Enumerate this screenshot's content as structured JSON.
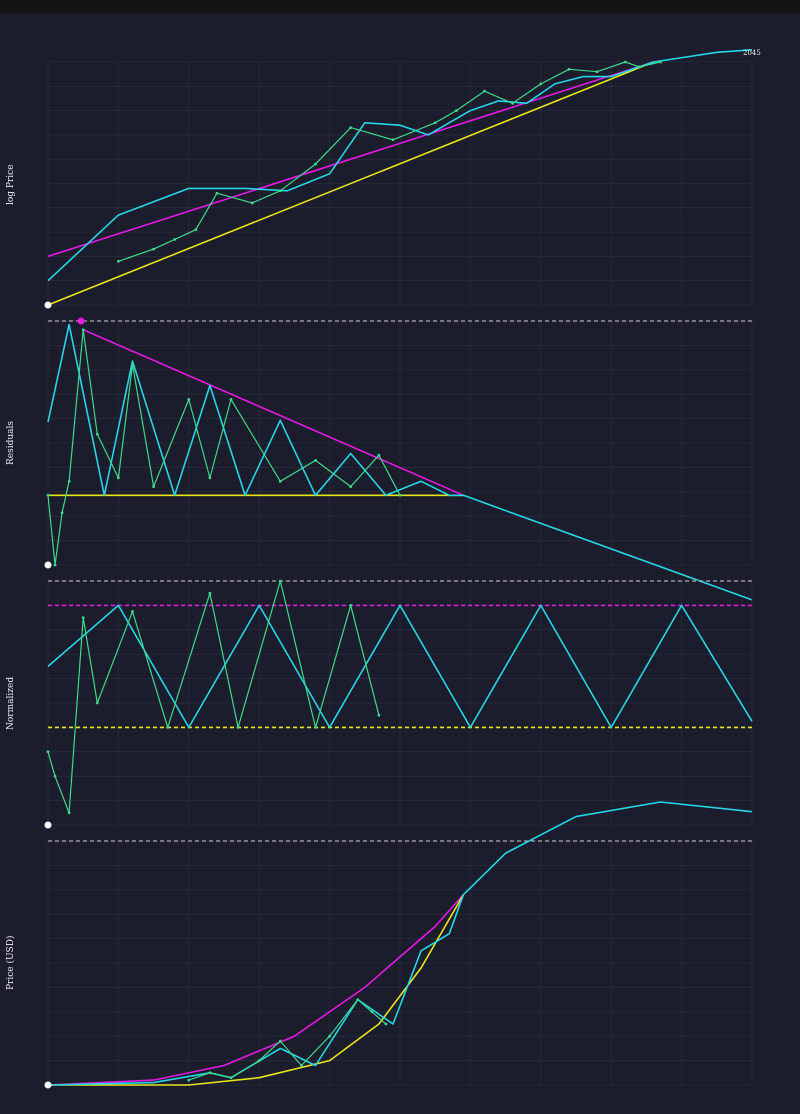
{
  "colors": {
    "background": "#1b1c2c",
    "grid": "#2f3144",
    "magenta": "#e619e6",
    "cyan": "#25d6e6",
    "yellow": "#e6e619",
    "candle_up": "#3fd98a",
    "candle_down": "#d9534f",
    "dashed_ref": "#cfcfcf",
    "marker": "#ffffff"
  },
  "annotations": {
    "end_year": "2045"
  },
  "chart_data": [
    {
      "id": "log-price",
      "type": "line",
      "ylabel": "log Price",
      "xlim": [
        0,
        1
      ],
      "ylim": [
        0,
        1
      ],
      "series": [
        {
          "role": "upper-band",
          "color": "magenta",
          "x": [
            0,
            0.86
          ],
          "y": [
            0.2,
            1.0
          ]
        },
        {
          "role": "lower-band",
          "color": "yellow",
          "x": [
            0,
            0.86
          ],
          "y": [
            0.0,
            1.0
          ]
        },
        {
          "role": "cycle-fit",
          "color": "cyan",
          "x": [
            0,
            0.1,
            0.2,
            0.28,
            0.34,
            0.4,
            0.45,
            0.5,
            0.54,
            0.6,
            0.64,
            0.68,
            0.72,
            0.76,
            0.8,
            0.86,
            0.95,
            1.0
          ],
          "y": [
            0.1,
            0.37,
            0.48,
            0.48,
            0.47,
            0.54,
            0.75,
            0.74,
            0.7,
            0.8,
            0.84,
            0.83,
            0.91,
            0.94,
            0.94,
            1.0,
            1.04,
            1.05
          ]
        },
        {
          "role": "price",
          "color": "candle_up",
          "x": [
            0.1,
            0.15,
            0.18,
            0.21,
            0.24,
            0.29,
            0.33,
            0.38,
            0.43,
            0.49,
            0.55,
            0.58,
            0.62,
            0.66,
            0.7,
            0.74,
            0.78,
            0.82,
            0.84,
            0.87
          ],
          "y": [
            0.18,
            0.23,
            0.27,
            0.31,
            0.46,
            0.42,
            0.47,
            0.58,
            0.73,
            0.68,
            0.75,
            0.8,
            0.88,
            0.83,
            0.91,
            0.97,
            0.96,
            1.0,
            0.98,
            1.0
          ]
        }
      ]
    },
    {
      "id": "residuals",
      "type": "line",
      "ylabel": "Residuals",
      "xlim": [
        0,
        1
      ],
      "ylim": [
        -0.4,
        1.0
      ],
      "series": [
        {
          "role": "upper-trend",
          "color": "magenta",
          "x": [
            0.05,
            0.59
          ],
          "y": [
            0.95,
            0.0
          ]
        },
        {
          "role": "baseline",
          "color": "yellow",
          "x": [
            0,
            0.59
          ],
          "y": [
            0.0,
            0.0
          ]
        },
        {
          "role": "projection",
          "color": "cyan",
          "x": [
            0.59,
            1.0
          ],
          "y": [
            0.0,
            -0.6
          ]
        },
        {
          "role": "cycle-fit",
          "color": "cyan",
          "x": [
            0,
            0.03,
            0.08,
            0.12,
            0.18,
            0.23,
            0.28,
            0.33,
            0.38,
            0.43,
            0.48,
            0.53,
            0.57,
            0.59
          ],
          "y": [
            0.42,
            0.98,
            0.0,
            0.77,
            0.0,
            0.63,
            0.0,
            0.43,
            0.0,
            0.24,
            0.0,
            0.08,
            0.0,
            0.0
          ]
        },
        {
          "role": "price",
          "color": "candle_up",
          "x": [
            0.0,
            0.01,
            0.02,
            0.03,
            0.05,
            0.07,
            0.1,
            0.12,
            0.15,
            0.2,
            0.23,
            0.26,
            0.33,
            0.38,
            0.43,
            0.47,
            0.5
          ],
          "y": [
            0.0,
            -0.4,
            -0.1,
            0.08,
            0.95,
            0.35,
            0.1,
            0.75,
            0.05,
            0.55,
            0.1,
            0.55,
            0.08,
            0.2,
            0.05,
            0.23,
            0.0
          ]
        }
      ]
    },
    {
      "id": "normalized",
      "type": "line",
      "ylabel": "Normalized",
      "xlim": [
        0,
        1
      ],
      "ylim": [
        -0.8,
        1.2
      ],
      "series": [
        {
          "role": "upper-level",
          "color": "magenta",
          "dashed": true,
          "x": [
            0,
            1
          ],
          "y": [
            1.0,
            1.0
          ]
        },
        {
          "role": "lower-level",
          "color": "yellow",
          "dashed": true,
          "x": [
            0,
            1
          ],
          "y": [
            0.0,
            0.0
          ]
        },
        {
          "role": "cycle-fit",
          "color": "cyan",
          "x": [
            0,
            0.1,
            0.2,
            0.3,
            0.4,
            0.5,
            0.6,
            0.7,
            0.8,
            0.9,
            1.0
          ],
          "y": [
            0.5,
            1.0,
            0.0,
            1.0,
            0.0,
            1.0,
            0.0,
            1.0,
            0.0,
            1.0,
            0.05
          ]
        },
        {
          "role": "price",
          "color": "candle_up",
          "x": [
            0.0,
            0.01,
            0.03,
            0.05,
            0.07,
            0.12,
            0.17,
            0.23,
            0.27,
            0.33,
            0.38,
            0.43,
            0.47
          ],
          "y": [
            -0.2,
            -0.4,
            -0.7,
            0.9,
            0.2,
            0.95,
            0.0,
            1.1,
            0.0,
            1.2,
            0.0,
            1.0,
            0.1
          ]
        }
      ]
    },
    {
      "id": "price-usd",
      "type": "line",
      "ylabel": "Price (USD)",
      "xlim": [
        0,
        1
      ],
      "ylim": [
        0,
        1.0
      ],
      "series": [
        {
          "role": "upper-curve",
          "color": "magenta",
          "x": [
            0,
            0.15,
            0.25,
            0.35,
            0.45,
            0.55,
            0.59
          ],
          "y": [
            0.0,
            0.02,
            0.08,
            0.2,
            0.4,
            0.65,
            0.78
          ]
        },
        {
          "role": "lower-curve",
          "color": "yellow",
          "x": [
            0,
            0.2,
            0.3,
            0.4,
            0.47,
            0.53,
            0.59
          ],
          "y": [
            0.0,
            0.0,
            0.03,
            0.1,
            0.25,
            0.48,
            0.78
          ]
        },
        {
          "role": "cycle-fit",
          "color": "cyan",
          "x": [
            0,
            0.15,
            0.23,
            0.26,
            0.33,
            0.38,
            0.44,
            0.49,
            0.53,
            0.57,
            0.59,
            0.65,
            0.75,
            0.87,
            1.0
          ],
          "y": [
            0.0,
            0.01,
            0.05,
            0.03,
            0.15,
            0.08,
            0.35,
            0.25,
            0.55,
            0.62,
            0.78,
            0.95,
            1.1,
            1.16,
            1.12
          ]
        },
        {
          "role": "price",
          "color": "candle_up",
          "x": [
            0.2,
            0.23,
            0.26,
            0.3,
            0.33,
            0.36,
            0.4,
            0.44,
            0.46,
            0.48
          ],
          "y": [
            0.02,
            0.05,
            0.03,
            0.1,
            0.18,
            0.08,
            0.2,
            0.35,
            0.3,
            0.25
          ]
        }
      ]
    }
  ]
}
